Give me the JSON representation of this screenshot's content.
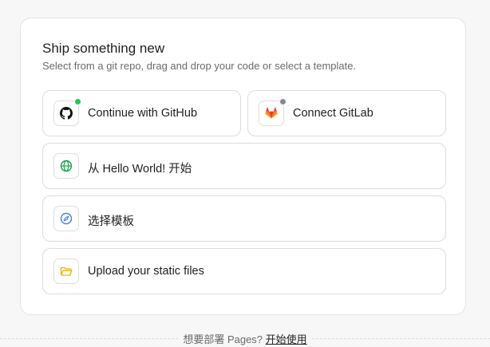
{
  "panel": {
    "title": "Ship something new",
    "subtitle": "Select from a git repo, drag and drop your code or select a template."
  },
  "options": [
    {
      "label": "Continue with GitHub",
      "icon": "github-icon",
      "status_color": "#22c55e"
    },
    {
      "label": "Connect GitLab",
      "icon": "gitlab-icon",
      "status_color": "#8a8a8a"
    },
    {
      "label": "从 Hello World! 开始",
      "icon": "globe-icon",
      "icon_color": "#16a34a"
    },
    {
      "label": "选择模板",
      "icon": "compass-icon",
      "icon_color": "#3b82f6"
    },
    {
      "label": "Upload your static files",
      "icon": "folder-icon",
      "icon_color": "#eab308"
    }
  ],
  "footer": {
    "prompt": "想要部署 Pages?",
    "link": "开始使用"
  },
  "colors": {
    "gitlab_orange": "#e24329",
    "github_black": "#111111"
  }
}
